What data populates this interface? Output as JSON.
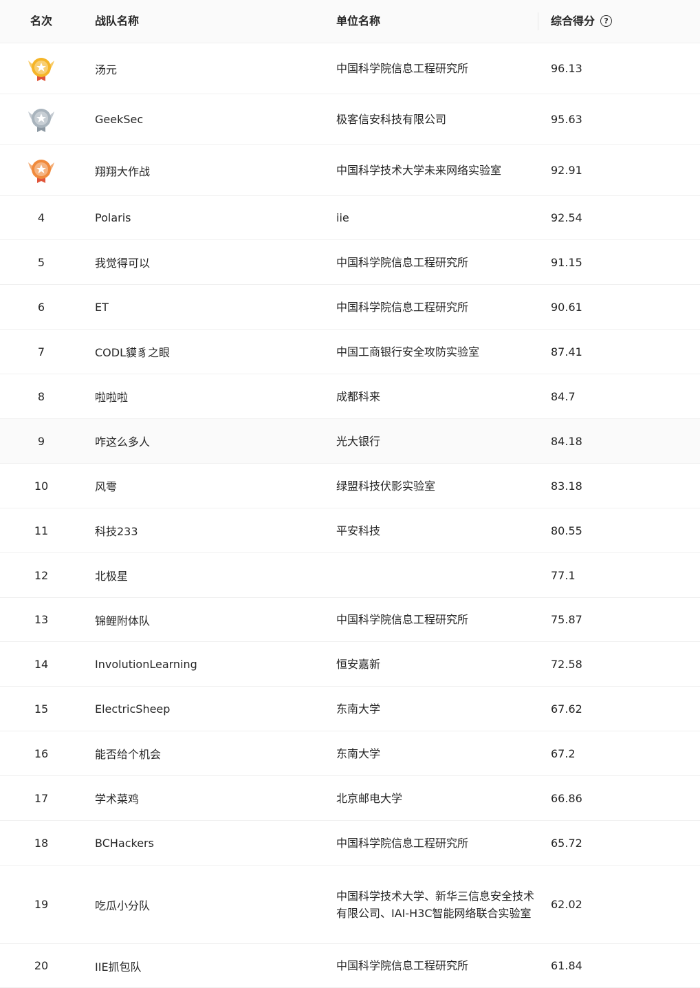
{
  "header": {
    "rank": "名次",
    "team": "战队名称",
    "org": "单位名称",
    "score": "综合得分",
    "help_icon": "?"
  },
  "colors": {
    "gold": "#f5b528",
    "silver": "#a9b4bd",
    "bronze": "#f08a3c"
  },
  "rows": [
    {
      "rank": "",
      "medal": "gold-medal-icon",
      "team": "汤元",
      "org": "中国科学院信息工程研究所",
      "score": "96.13"
    },
    {
      "rank": "",
      "medal": "silver-medal-icon",
      "team": "GeekSec",
      "org": "极客信安科技有限公司",
      "score": "95.63"
    },
    {
      "rank": "",
      "medal": "bronze-medal-icon",
      "team": "翔翔大作战",
      "org": "中国科学技术大学未来网络实验室",
      "score": "92.91"
    },
    {
      "rank": "4",
      "team": "Polaris",
      "org": "iie",
      "score": "92.54"
    },
    {
      "rank": "5",
      "team": "我觉得可以",
      "org": "中国科学院信息工程研究所",
      "score": "91.15"
    },
    {
      "rank": "6",
      "team": "ET",
      "org": "中国科学院信息工程研究所",
      "score": "90.61"
    },
    {
      "rank": "7",
      "team": "CODL貘豸之眼",
      "org": "中国工商银行安全攻防实验室",
      "score": "87.41"
    },
    {
      "rank": "8",
      "team": "啦啦啦",
      "org": "成都科来",
      "score": "84.7"
    },
    {
      "rank": "9",
      "team": "咋这么多人",
      "org": "光大银行",
      "score": "84.18"
    },
    {
      "rank": "10",
      "team": "风雩",
      "org": "绿盟科技伏影实验室",
      "score": "83.18"
    },
    {
      "rank": "11",
      "team": "科技233",
      "org": "平安科技",
      "score": "80.55"
    },
    {
      "rank": "12",
      "team": "北极星",
      "org": "",
      "score": "77.1"
    },
    {
      "rank": "13",
      "team": "锦鲤附体队",
      "org": "中国科学院信息工程研究所",
      "score": "75.87"
    },
    {
      "rank": "14",
      "team": "InvolutionLearning",
      "org": "恒安嘉新",
      "score": "72.58"
    },
    {
      "rank": "15",
      "team": "ElectricSheep",
      "org": "东南大学",
      "score": "67.62"
    },
    {
      "rank": "16",
      "team": "能否给个机会",
      "org": "东南大学",
      "score": "67.2"
    },
    {
      "rank": "17",
      "team": "学术菜鸡",
      "org": "北京邮电大学",
      "score": "66.86"
    },
    {
      "rank": "18",
      "team": "BCHackers",
      "org": "中国科学院信息工程研究所",
      "score": "65.72"
    },
    {
      "rank": "19",
      "team": "吃瓜小分队",
      "org": "中国科学技术大学、新华三信息安全技术有限公司、IAI-H3C智能网络联合实验室",
      "score": "62.02"
    },
    {
      "rank": "20",
      "team": "IIE抓包队",
      "org": "中国科学院信息工程研究所",
      "score": "61.84"
    }
  ]
}
